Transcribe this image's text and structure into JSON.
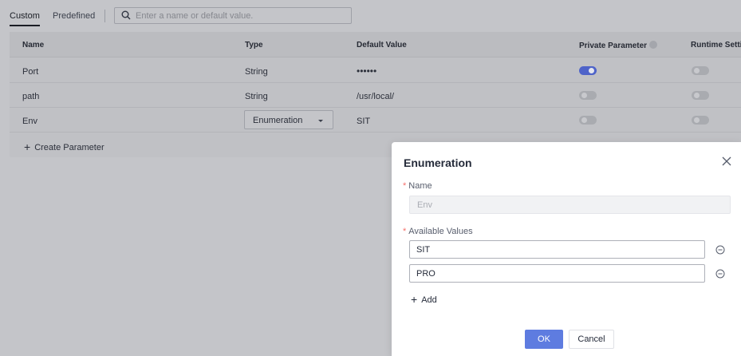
{
  "tabs": [
    {
      "label": "Custom",
      "active": true
    },
    {
      "label": "Predefined",
      "active": false
    }
  ],
  "search": {
    "placeholder": "Enter a name or default value.",
    "value": "",
    "icon": "search-icon"
  },
  "table": {
    "columns": [
      "Name",
      "Type",
      "Default Value",
      "Private Parameter",
      "Runtime Settin"
    ],
    "rows": [
      {
        "name": "Port",
        "type": "String",
        "default": "••••••",
        "private": true,
        "runtime": false
      },
      {
        "name": "path",
        "type": "String",
        "default": "/usr/local/",
        "private": false,
        "runtime": false
      },
      {
        "name": "Env",
        "type": "Enumeration",
        "default": "SIT",
        "private": false,
        "runtime": false
      }
    ],
    "create_label": "Create Parameter"
  },
  "dialog": {
    "title": "Enumeration",
    "name_label": "Name",
    "name_value": "Env",
    "values_label": "Available Values",
    "values": [
      "SIT",
      "PRO"
    ],
    "add_label": "Add",
    "ok_label": "OK",
    "cancel_label": "Cancel"
  },
  "colors": {
    "accent": "#5e7ce0",
    "toggle_on": "#4e63c9",
    "required": "#f66f6a"
  }
}
